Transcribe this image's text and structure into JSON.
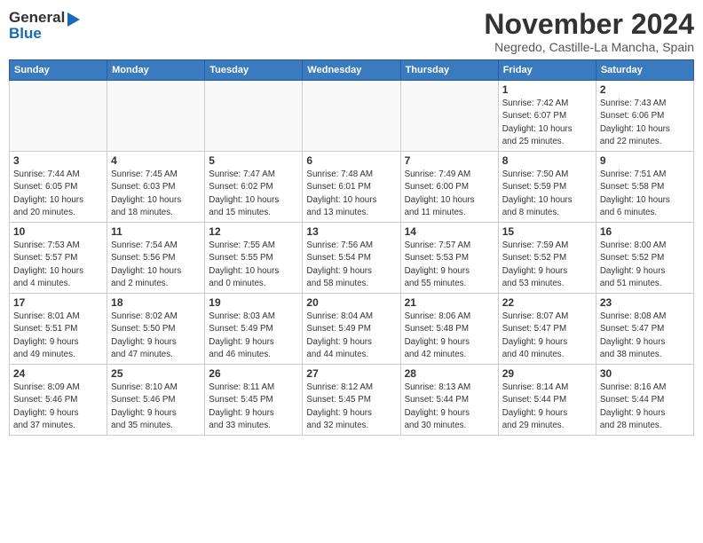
{
  "header": {
    "logo_line1": "General",
    "logo_line2": "Blue",
    "month": "November 2024",
    "location": "Negredo, Castille-La Mancha, Spain"
  },
  "calendar": {
    "days_of_week": [
      "Sunday",
      "Monday",
      "Tuesday",
      "Wednesday",
      "Thursday",
      "Friday",
      "Saturday"
    ],
    "weeks": [
      [
        {
          "day": "",
          "info": ""
        },
        {
          "day": "",
          "info": ""
        },
        {
          "day": "",
          "info": ""
        },
        {
          "day": "",
          "info": ""
        },
        {
          "day": "",
          "info": ""
        },
        {
          "day": "1",
          "info": "Sunrise: 7:42 AM\nSunset: 6:07 PM\nDaylight: 10 hours\nand 25 minutes."
        },
        {
          "day": "2",
          "info": "Sunrise: 7:43 AM\nSunset: 6:06 PM\nDaylight: 10 hours\nand 22 minutes."
        }
      ],
      [
        {
          "day": "3",
          "info": "Sunrise: 7:44 AM\nSunset: 6:05 PM\nDaylight: 10 hours\nand 20 minutes."
        },
        {
          "day": "4",
          "info": "Sunrise: 7:45 AM\nSunset: 6:03 PM\nDaylight: 10 hours\nand 18 minutes."
        },
        {
          "day": "5",
          "info": "Sunrise: 7:47 AM\nSunset: 6:02 PM\nDaylight: 10 hours\nand 15 minutes."
        },
        {
          "day": "6",
          "info": "Sunrise: 7:48 AM\nSunset: 6:01 PM\nDaylight: 10 hours\nand 13 minutes."
        },
        {
          "day": "7",
          "info": "Sunrise: 7:49 AM\nSunset: 6:00 PM\nDaylight: 10 hours\nand 11 minutes."
        },
        {
          "day": "8",
          "info": "Sunrise: 7:50 AM\nSunset: 5:59 PM\nDaylight: 10 hours\nand 8 minutes."
        },
        {
          "day": "9",
          "info": "Sunrise: 7:51 AM\nSunset: 5:58 PM\nDaylight: 10 hours\nand 6 minutes."
        }
      ],
      [
        {
          "day": "10",
          "info": "Sunrise: 7:53 AM\nSunset: 5:57 PM\nDaylight: 10 hours\nand 4 minutes."
        },
        {
          "day": "11",
          "info": "Sunrise: 7:54 AM\nSunset: 5:56 PM\nDaylight: 10 hours\nand 2 minutes."
        },
        {
          "day": "12",
          "info": "Sunrise: 7:55 AM\nSunset: 5:55 PM\nDaylight: 10 hours\nand 0 minutes."
        },
        {
          "day": "13",
          "info": "Sunrise: 7:56 AM\nSunset: 5:54 PM\nDaylight: 9 hours\nand 58 minutes."
        },
        {
          "day": "14",
          "info": "Sunrise: 7:57 AM\nSunset: 5:53 PM\nDaylight: 9 hours\nand 55 minutes."
        },
        {
          "day": "15",
          "info": "Sunrise: 7:59 AM\nSunset: 5:52 PM\nDaylight: 9 hours\nand 53 minutes."
        },
        {
          "day": "16",
          "info": "Sunrise: 8:00 AM\nSunset: 5:52 PM\nDaylight: 9 hours\nand 51 minutes."
        }
      ],
      [
        {
          "day": "17",
          "info": "Sunrise: 8:01 AM\nSunset: 5:51 PM\nDaylight: 9 hours\nand 49 minutes."
        },
        {
          "day": "18",
          "info": "Sunrise: 8:02 AM\nSunset: 5:50 PM\nDaylight: 9 hours\nand 47 minutes."
        },
        {
          "day": "19",
          "info": "Sunrise: 8:03 AM\nSunset: 5:49 PM\nDaylight: 9 hours\nand 46 minutes."
        },
        {
          "day": "20",
          "info": "Sunrise: 8:04 AM\nSunset: 5:49 PM\nDaylight: 9 hours\nand 44 minutes."
        },
        {
          "day": "21",
          "info": "Sunrise: 8:06 AM\nSunset: 5:48 PM\nDaylight: 9 hours\nand 42 minutes."
        },
        {
          "day": "22",
          "info": "Sunrise: 8:07 AM\nSunset: 5:47 PM\nDaylight: 9 hours\nand 40 minutes."
        },
        {
          "day": "23",
          "info": "Sunrise: 8:08 AM\nSunset: 5:47 PM\nDaylight: 9 hours\nand 38 minutes."
        }
      ],
      [
        {
          "day": "24",
          "info": "Sunrise: 8:09 AM\nSunset: 5:46 PM\nDaylight: 9 hours\nand 37 minutes."
        },
        {
          "day": "25",
          "info": "Sunrise: 8:10 AM\nSunset: 5:46 PM\nDaylight: 9 hours\nand 35 minutes."
        },
        {
          "day": "26",
          "info": "Sunrise: 8:11 AM\nSunset: 5:45 PM\nDaylight: 9 hours\nand 33 minutes."
        },
        {
          "day": "27",
          "info": "Sunrise: 8:12 AM\nSunset: 5:45 PM\nDaylight: 9 hours\nand 32 minutes."
        },
        {
          "day": "28",
          "info": "Sunrise: 8:13 AM\nSunset: 5:44 PM\nDaylight: 9 hours\nand 30 minutes."
        },
        {
          "day": "29",
          "info": "Sunrise: 8:14 AM\nSunset: 5:44 PM\nDaylight: 9 hours\nand 29 minutes."
        },
        {
          "day": "30",
          "info": "Sunrise: 8:16 AM\nSunset: 5:44 PM\nDaylight: 9 hours\nand 28 minutes."
        }
      ]
    ]
  }
}
